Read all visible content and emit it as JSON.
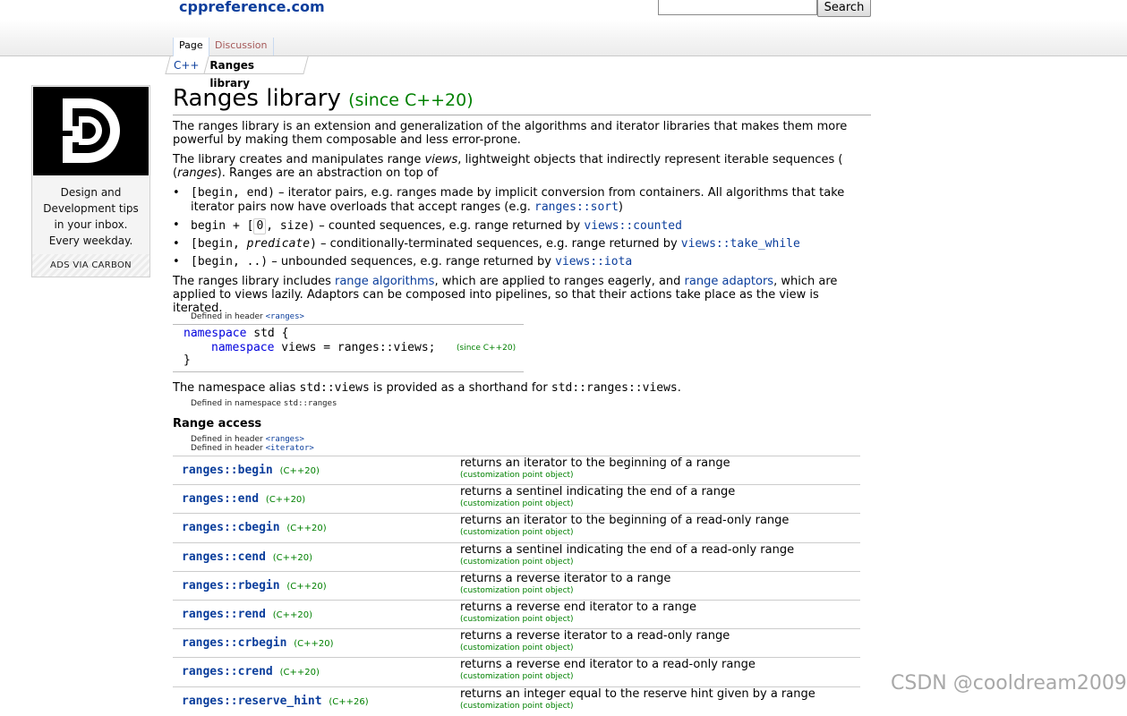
{
  "header": {
    "site_name": "cppreference.com",
    "search_placeholder": "",
    "search_button": "Search",
    "tabs": [
      "Page",
      "Discussion"
    ]
  },
  "breadcrumb": [
    "C++",
    "Ranges library"
  ],
  "ad": {
    "text": "Design and Development tips in your inbox. Every weekday.",
    "footer": "ADS VIA CARBON"
  },
  "article": {
    "title": "Ranges library",
    "title_since": "(since C++20)",
    "intro_1": "The ranges library is an extension and generalization of the algorithms and iterator libraries that makes them more powerful by making them composable and less error-prone.",
    "intro_2_a": "The library creates and manipulates range ",
    "intro_2_views": "views",
    "intro_2_b": ", lightweight objects that indirectly represent iterable sequences (",
    "intro_2_ranges": "ranges",
    "intro_2_c": "). Ranges are an abstraction on top of",
    "bullets": [
      {
        "code": "[begin,  end)",
        "text_1": " – iterator pairs, e.g. ranges made by implicit conversion from containers. All algorithms that take",
        "text_2": "iterator pairs now have overloads that accept ranges (e.g. ",
        "link": "ranges::sort",
        "tail": ")"
      },
      {
        "code_a": "begin + [",
        "code_box": "0",
        "code_b": ", size)",
        "text": " – counted sequences, e.g. range returned by ",
        "link": "views::counted"
      },
      {
        "code_a": "[begin, ",
        "code_pred": "predicate",
        "code_b": ")",
        "text": " – conditionally-terminated sequences, e.g. range returned by ",
        "link": "views::take_while"
      },
      {
        "code": "[begin, ..)",
        "text": " – unbounded sequences, e.g. range returned by ",
        "link": "views::iota"
      }
    ],
    "adaptors_a": "The ranges library includes ",
    "adaptors_link1": "range algorithms",
    "adaptors_b": ", which are applied to ranges eagerly, and ",
    "adaptors_link2": "range adaptors",
    "adaptors_c": ", which are",
    "adaptors_line2": "applied to views lazily. Adaptors can be composed into pipelines, so that their actions take place as the view is iterated.",
    "def_header_prefix": "Defined in header ",
    "def_header_ranges": "<ranges>",
    "def_header_iterator": "<iterator>",
    "ns_code_line1_kw": "namespace",
    "ns_code_line1_rest": " std {",
    "ns_code_line2_kw": "namespace",
    "ns_code_line2_rest": " views = ranges::views;",
    "ns_code_line3": "}",
    "ns_since": "(since C++20)",
    "alias_a": "The namespace alias ",
    "alias_code1": "std::views",
    "alias_b": " is provided as a shorthand for ",
    "alias_code2": "std::ranges::views",
    "alias_c": ".",
    "def_namespace_prefix": "Defined in namespace ",
    "def_namespace_name": "std::ranges",
    "range_access_heading": "Range access"
  },
  "range_access": [
    {
      "name": "ranges::begin",
      "ver": "(C++20)",
      "desc": "returns an iterator to the beginning of a range",
      "note": "(customization point object)"
    },
    {
      "name": "ranges::end",
      "ver": "(C++20)",
      "desc": "returns a sentinel indicating the end of a range",
      "note": "(customization point object)"
    },
    {
      "name": "ranges::cbegin",
      "ver": "(C++20)",
      "desc": "returns an iterator to the beginning of a read-only range",
      "note": "(customization point object)"
    },
    {
      "name": "ranges::cend",
      "ver": "(C++20)",
      "desc": "returns a sentinel indicating the end of a read-only range",
      "note": "(customization point object)"
    },
    {
      "name": "ranges::rbegin",
      "ver": "(C++20)",
      "desc": "returns a reverse iterator to a range",
      "note": "(customization point object)"
    },
    {
      "name": "ranges::rend",
      "ver": "(C++20)",
      "desc": "returns a reverse end iterator to a range",
      "note": "(customization point object)"
    },
    {
      "name": "ranges::crbegin",
      "ver": "(C++20)",
      "desc": "returns a reverse iterator to a read-only range",
      "note": "(customization point object)"
    },
    {
      "name": "ranges::crend",
      "ver": "(C++20)",
      "desc": "returns a reverse end iterator to a read-only range",
      "note": "(customization point object)"
    },
    {
      "name": "ranges::reserve_hint",
      "ver": "(C++26)",
      "desc": "returns an integer equal to the reserve hint given by a range",
      "note": "(customization point object)"
    }
  ],
  "watermark": "CSDN @cooldream2009",
  "colors": {
    "link": "#0b3e9c",
    "since": "#008000",
    "keyword": "#0000dd"
  }
}
